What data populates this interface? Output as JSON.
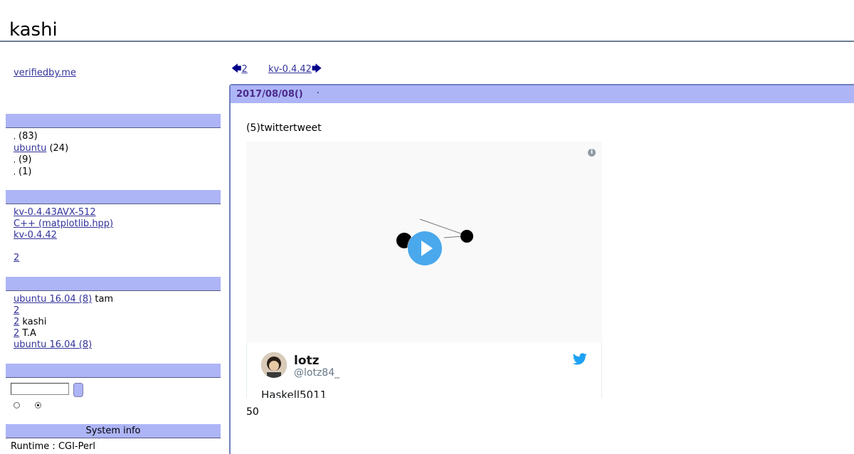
{
  "site": {
    "title": "kashi"
  },
  "sidebar": {
    "top_link": "verifiedby.me",
    "categories": {
      "items": [
        {
          "label": "",
          "count": "(83)"
        },
        {
          "label": "ubuntu",
          "count": "(24)"
        },
        {
          "label": "",
          "count": "(9)"
        },
        {
          "label": "",
          "count": "(1)"
        }
      ]
    },
    "recent": {
      "items": [
        "kv-0.4.43AVX-512",
        "C++ (matplotlib.hpp)",
        "kv-0.4.42",
        "2"
      ]
    },
    "comments": {
      "items": [
        {
          "link": "ubuntu 16.04 (8)",
          "by": "tam"
        },
        {
          "link": "2",
          "by": ""
        },
        {
          "link": "2",
          "by": "kashi"
        },
        {
          "link": "2",
          "by": "T.A"
        },
        {
          "link": "ubuntu 16.04 (8)",
          "by": ""
        }
      ]
    },
    "system_info": {
      "title": "System info",
      "runtime": "Runtime : CGI-Perl"
    }
  },
  "nav": {
    "prev_label": "2",
    "next_label": "kv-0.4.42"
  },
  "entry": {
    "date": "2017/08/08()",
    "dot": ".",
    "text": "(5)twittertweet",
    "tweet": {
      "author_name": "lotz",
      "author_handle": "@lotz84_",
      "text": "Haskell5011",
      "info_glyph": "i",
      "brand_color": "#1da1f2"
    },
    "footer_number": "50"
  }
}
